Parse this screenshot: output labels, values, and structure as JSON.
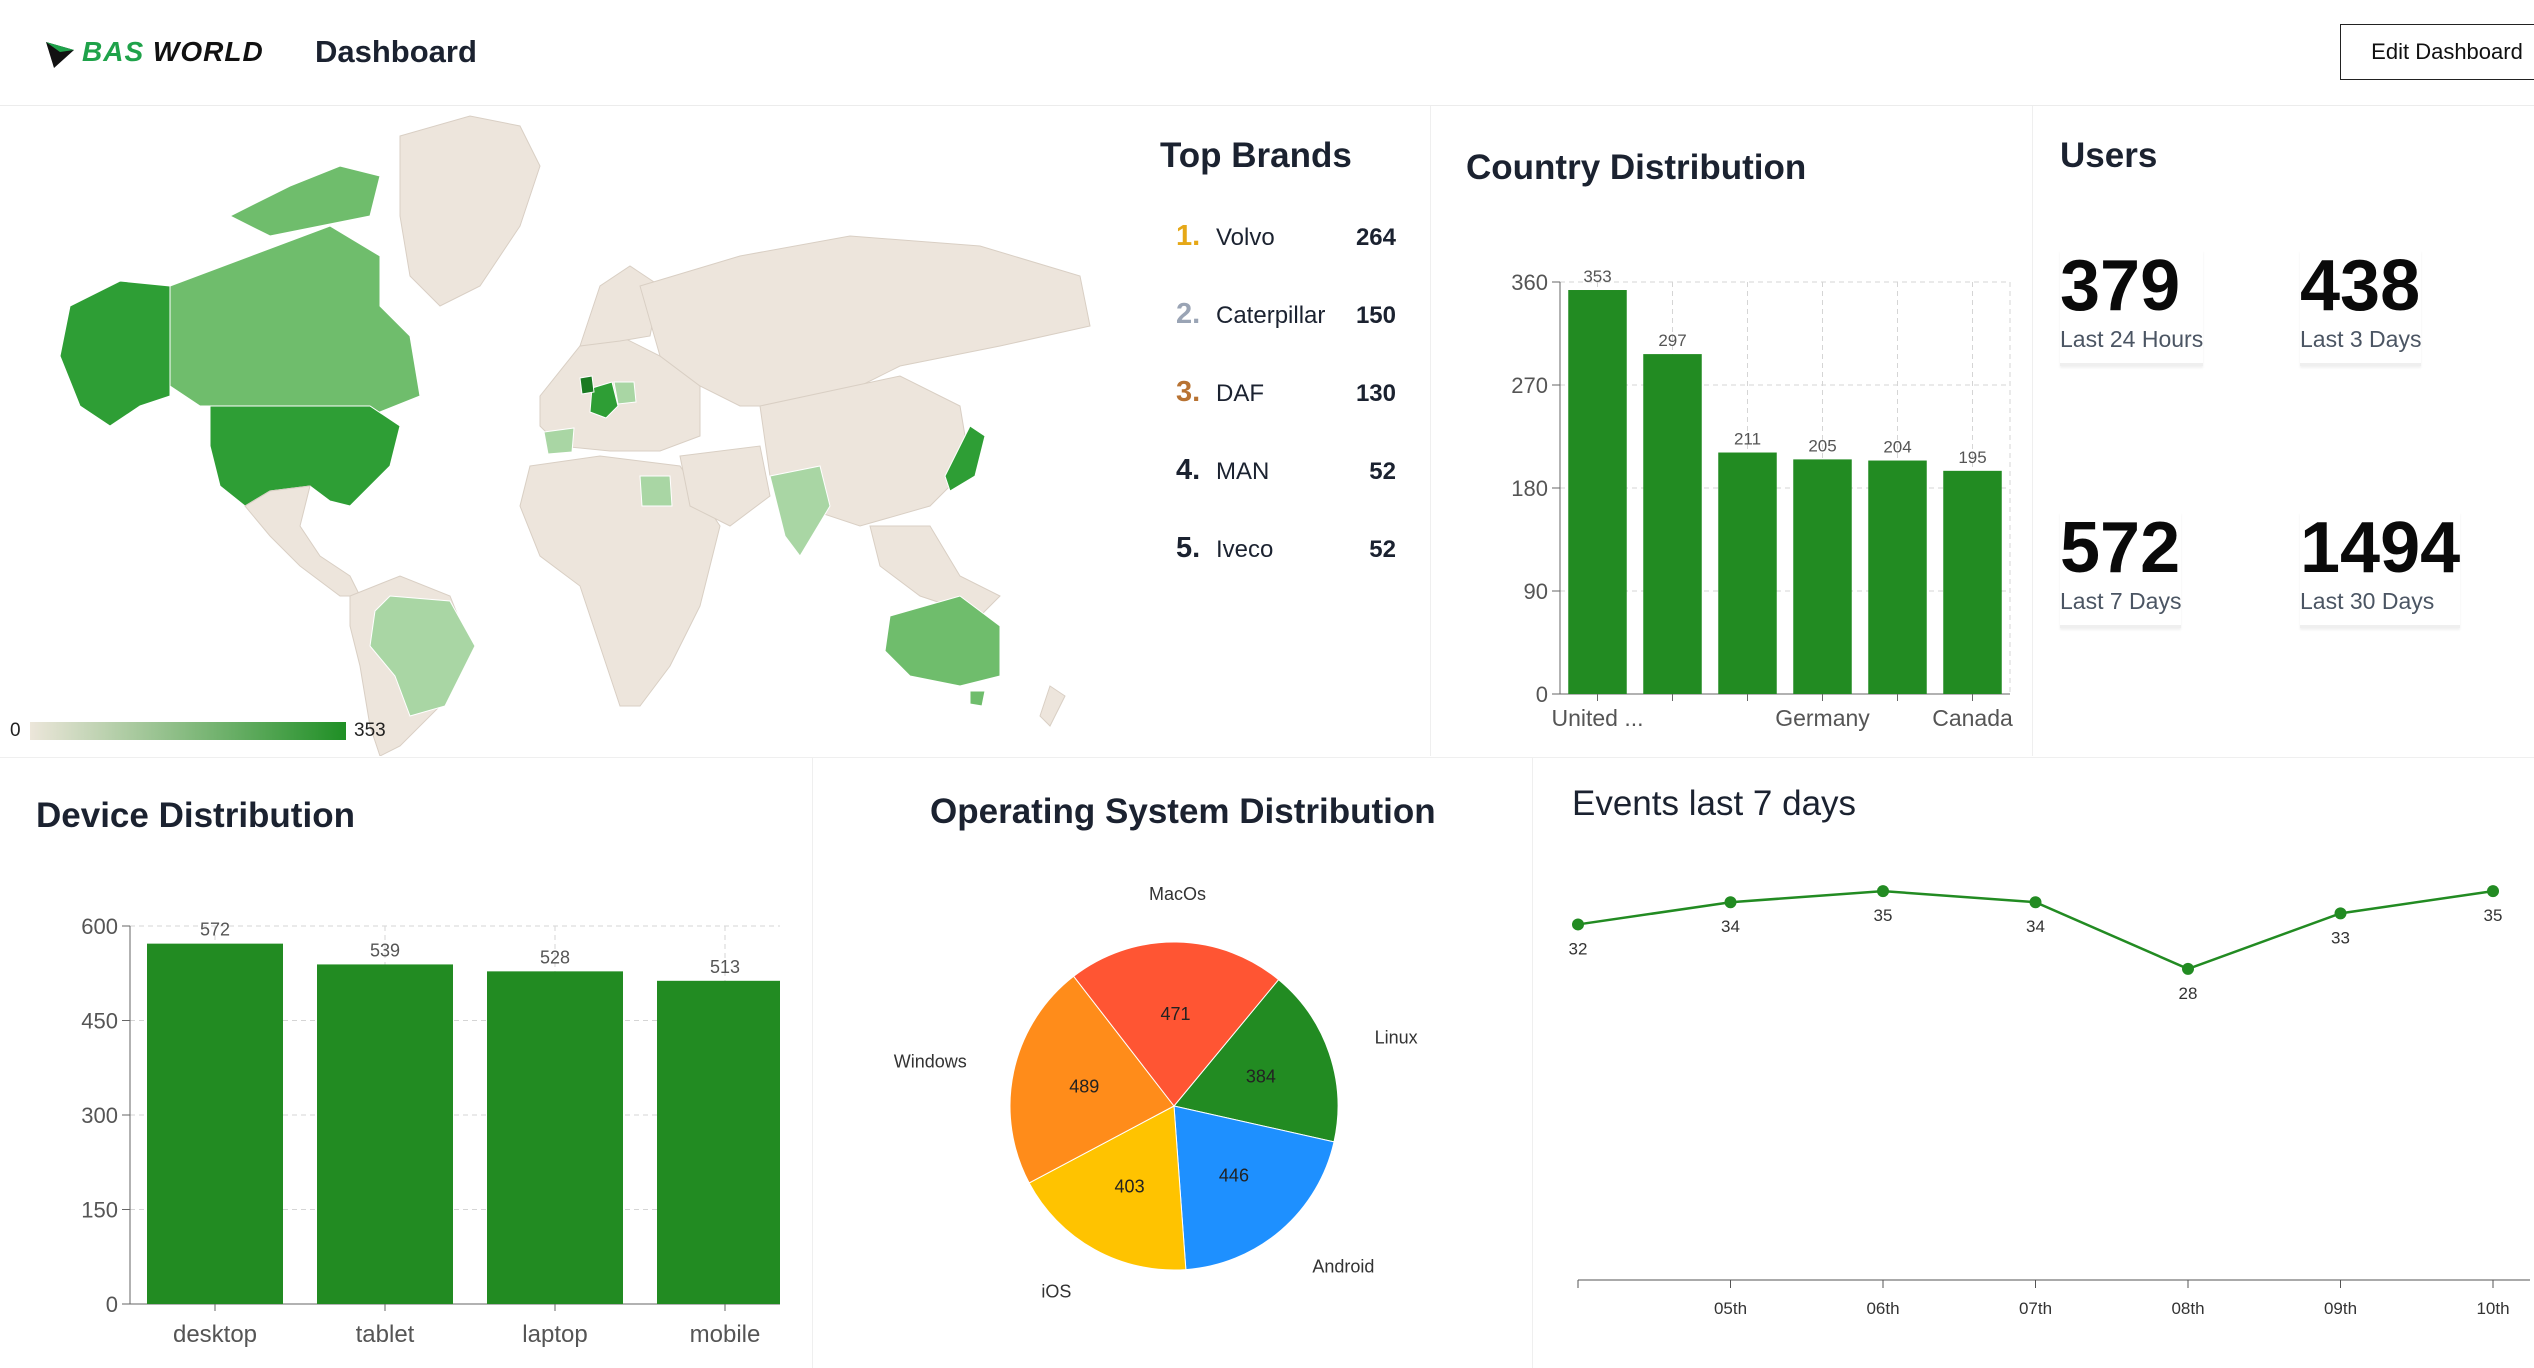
{
  "header": {
    "brand_a": "BAS",
    "brand_b": "WORLD",
    "title": "Dashboard",
    "edit_label": "Edit Dashboard"
  },
  "colors": {
    "bar_green": "#228b22",
    "map_land": "#ede5dc",
    "map_low": "#a9d6a4",
    "map_mid": "#6fbd6c",
    "map_high": "#2e9e35",
    "rank_gold": "#e6a817",
    "rank_silver": "#9aa4b5",
    "rank_bronze": "#b87333"
  },
  "map": {
    "legend_min": "0",
    "legend_max": "353"
  },
  "top_brands": {
    "title": "Top Brands",
    "items": [
      {
        "rank": "1.",
        "name": "Volvo",
        "value": "264"
      },
      {
        "rank": "2.",
        "name": "Caterpillar",
        "value": "150"
      },
      {
        "rank": "3.",
        "name": "DAF",
        "value": "130"
      },
      {
        "rank": "4.",
        "name": "MAN",
        "value": "52"
      },
      {
        "rank": "5.",
        "name": "Iveco",
        "value": "52"
      }
    ]
  },
  "country": {
    "title": "Country Distribution"
  },
  "users": {
    "title": "Users",
    "stats": [
      {
        "value": "379",
        "label": "Last 24 Hours"
      },
      {
        "value": "438",
        "label": "Last 3 Days"
      },
      {
        "value": "572",
        "label": "Last 7 Days"
      },
      {
        "value": "1494",
        "label": "Last 30 Days"
      }
    ]
  },
  "device": {
    "title": "Device Distribution"
  },
  "os": {
    "title": "Operating System Distribution"
  },
  "events": {
    "title": "Events last 7 days"
  },
  "chart_data": [
    {
      "id": "country",
      "type": "bar",
      "title": "Country Distribution",
      "categories": [
        "United ...",
        "",
        "",
        "Germany",
        "",
        "Canada"
      ],
      "values": [
        353,
        297,
        211,
        205,
        204,
        195
      ],
      "value_labels": [
        "353",
        "297",
        "211",
        "205",
        "204",
        "195"
      ],
      "y_ticks": [
        0,
        90,
        180,
        270,
        360
      ],
      "ylim": [
        0,
        360
      ],
      "grid": true
    },
    {
      "id": "device",
      "type": "bar",
      "title": "Device Distribution",
      "categories": [
        "desktop",
        "tablet",
        "laptop",
        "mobile"
      ],
      "values": [
        572,
        539,
        528,
        513
      ],
      "y_ticks": [
        0,
        150,
        300,
        450,
        600
      ],
      "ylim": [
        0,
        600
      ],
      "grid": true
    },
    {
      "id": "os",
      "type": "pie",
      "title": "Operating System Distribution",
      "slices": [
        {
          "label": "Linux",
          "value": 384,
          "color": "#228b22"
        },
        {
          "label": "Android",
          "value": 446,
          "color": "#1e90ff"
        },
        {
          "label": "iOS",
          "value": 403,
          "color": "#ffc300"
        },
        {
          "label": "Windows",
          "value": 489,
          "color": "#ff8c1a"
        },
        {
          "label": "MacOs",
          "value": 471,
          "color": "#ff5533"
        }
      ]
    },
    {
      "id": "events",
      "type": "line",
      "title": "Events last 7 days",
      "x": [
        "",
        "05th",
        "06th",
        "07th",
        "08th",
        "09th",
        "10th"
      ],
      "values": [
        32,
        34,
        35,
        34,
        28,
        33,
        35
      ],
      "color": "#228b22",
      "ylim": [
        0,
        36
      ]
    }
  ]
}
